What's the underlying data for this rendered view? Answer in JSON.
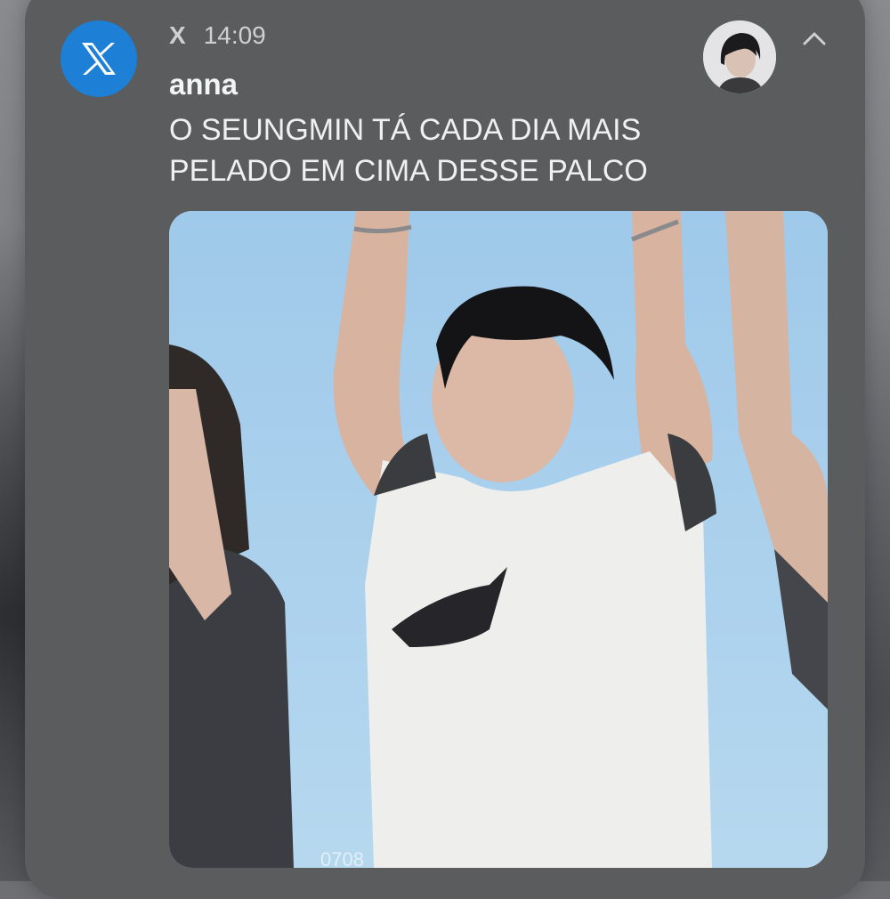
{
  "notification": {
    "app_name": "X",
    "time": "14:09",
    "author": "anna",
    "message": "O SEUNGMIN TÁ CADA DIA MAIS PELADO EM CIMA DESSE PALCO",
    "icons": {
      "app": "x-logo-icon",
      "avatar": "user-avatar",
      "collapse": "chevron-up-icon"
    },
    "colors": {
      "card": "#5b5c5e",
      "app_icon_bg": "#1d7fd6",
      "text_primary": "#f0f0f0",
      "text_secondary": "#cfd0d2"
    }
  },
  "media": {
    "watermark": "0708"
  }
}
